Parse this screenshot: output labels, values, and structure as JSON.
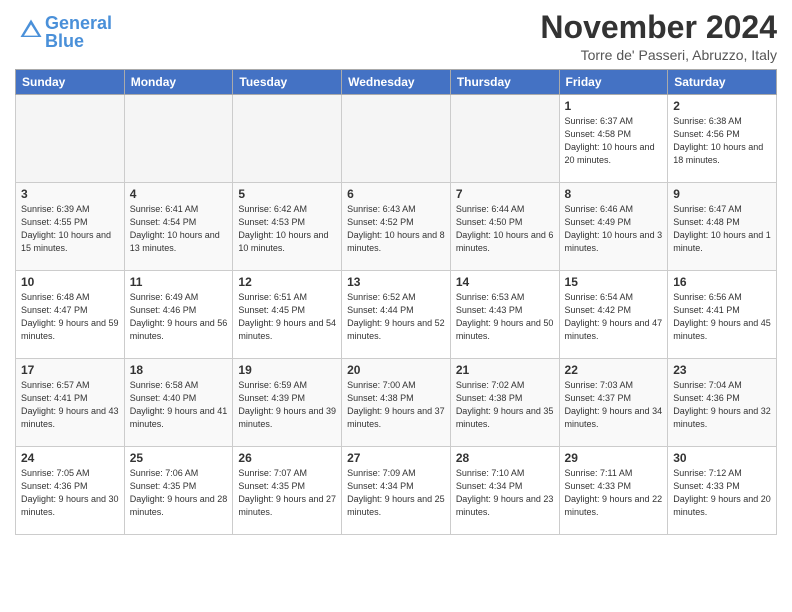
{
  "logo": {
    "text_general": "General",
    "text_blue": "Blue"
  },
  "header": {
    "month": "November 2024",
    "location": "Torre de' Passeri, Abruzzo, Italy"
  },
  "weekdays": [
    "Sunday",
    "Monday",
    "Tuesday",
    "Wednesday",
    "Thursday",
    "Friday",
    "Saturday"
  ],
  "weeks": [
    [
      {
        "day": "",
        "info": ""
      },
      {
        "day": "",
        "info": ""
      },
      {
        "day": "",
        "info": ""
      },
      {
        "day": "",
        "info": ""
      },
      {
        "day": "",
        "info": ""
      },
      {
        "day": "1",
        "info": "Sunrise: 6:37 AM\nSunset: 4:58 PM\nDaylight: 10 hours and 20 minutes."
      },
      {
        "day": "2",
        "info": "Sunrise: 6:38 AM\nSunset: 4:56 PM\nDaylight: 10 hours and 18 minutes."
      }
    ],
    [
      {
        "day": "3",
        "info": "Sunrise: 6:39 AM\nSunset: 4:55 PM\nDaylight: 10 hours and 15 minutes."
      },
      {
        "day": "4",
        "info": "Sunrise: 6:41 AM\nSunset: 4:54 PM\nDaylight: 10 hours and 13 minutes."
      },
      {
        "day": "5",
        "info": "Sunrise: 6:42 AM\nSunset: 4:53 PM\nDaylight: 10 hours and 10 minutes."
      },
      {
        "day": "6",
        "info": "Sunrise: 6:43 AM\nSunset: 4:52 PM\nDaylight: 10 hours and 8 minutes."
      },
      {
        "day": "7",
        "info": "Sunrise: 6:44 AM\nSunset: 4:50 PM\nDaylight: 10 hours and 6 minutes."
      },
      {
        "day": "8",
        "info": "Sunrise: 6:46 AM\nSunset: 4:49 PM\nDaylight: 10 hours and 3 minutes."
      },
      {
        "day": "9",
        "info": "Sunrise: 6:47 AM\nSunset: 4:48 PM\nDaylight: 10 hours and 1 minute."
      }
    ],
    [
      {
        "day": "10",
        "info": "Sunrise: 6:48 AM\nSunset: 4:47 PM\nDaylight: 9 hours and 59 minutes."
      },
      {
        "day": "11",
        "info": "Sunrise: 6:49 AM\nSunset: 4:46 PM\nDaylight: 9 hours and 56 minutes."
      },
      {
        "day": "12",
        "info": "Sunrise: 6:51 AM\nSunset: 4:45 PM\nDaylight: 9 hours and 54 minutes."
      },
      {
        "day": "13",
        "info": "Sunrise: 6:52 AM\nSunset: 4:44 PM\nDaylight: 9 hours and 52 minutes."
      },
      {
        "day": "14",
        "info": "Sunrise: 6:53 AM\nSunset: 4:43 PM\nDaylight: 9 hours and 50 minutes."
      },
      {
        "day": "15",
        "info": "Sunrise: 6:54 AM\nSunset: 4:42 PM\nDaylight: 9 hours and 47 minutes."
      },
      {
        "day": "16",
        "info": "Sunrise: 6:56 AM\nSunset: 4:41 PM\nDaylight: 9 hours and 45 minutes."
      }
    ],
    [
      {
        "day": "17",
        "info": "Sunrise: 6:57 AM\nSunset: 4:41 PM\nDaylight: 9 hours and 43 minutes."
      },
      {
        "day": "18",
        "info": "Sunrise: 6:58 AM\nSunset: 4:40 PM\nDaylight: 9 hours and 41 minutes."
      },
      {
        "day": "19",
        "info": "Sunrise: 6:59 AM\nSunset: 4:39 PM\nDaylight: 9 hours and 39 minutes."
      },
      {
        "day": "20",
        "info": "Sunrise: 7:00 AM\nSunset: 4:38 PM\nDaylight: 9 hours and 37 minutes."
      },
      {
        "day": "21",
        "info": "Sunrise: 7:02 AM\nSunset: 4:38 PM\nDaylight: 9 hours and 35 minutes."
      },
      {
        "day": "22",
        "info": "Sunrise: 7:03 AM\nSunset: 4:37 PM\nDaylight: 9 hours and 34 minutes."
      },
      {
        "day": "23",
        "info": "Sunrise: 7:04 AM\nSunset: 4:36 PM\nDaylight: 9 hours and 32 minutes."
      }
    ],
    [
      {
        "day": "24",
        "info": "Sunrise: 7:05 AM\nSunset: 4:36 PM\nDaylight: 9 hours and 30 minutes."
      },
      {
        "day": "25",
        "info": "Sunrise: 7:06 AM\nSunset: 4:35 PM\nDaylight: 9 hours and 28 minutes."
      },
      {
        "day": "26",
        "info": "Sunrise: 7:07 AM\nSunset: 4:35 PM\nDaylight: 9 hours and 27 minutes."
      },
      {
        "day": "27",
        "info": "Sunrise: 7:09 AM\nSunset: 4:34 PM\nDaylight: 9 hours and 25 minutes."
      },
      {
        "day": "28",
        "info": "Sunrise: 7:10 AM\nSunset: 4:34 PM\nDaylight: 9 hours and 23 minutes."
      },
      {
        "day": "29",
        "info": "Sunrise: 7:11 AM\nSunset: 4:33 PM\nDaylight: 9 hours and 22 minutes."
      },
      {
        "day": "30",
        "info": "Sunrise: 7:12 AM\nSunset: 4:33 PM\nDaylight: 9 hours and 20 minutes."
      }
    ]
  ]
}
